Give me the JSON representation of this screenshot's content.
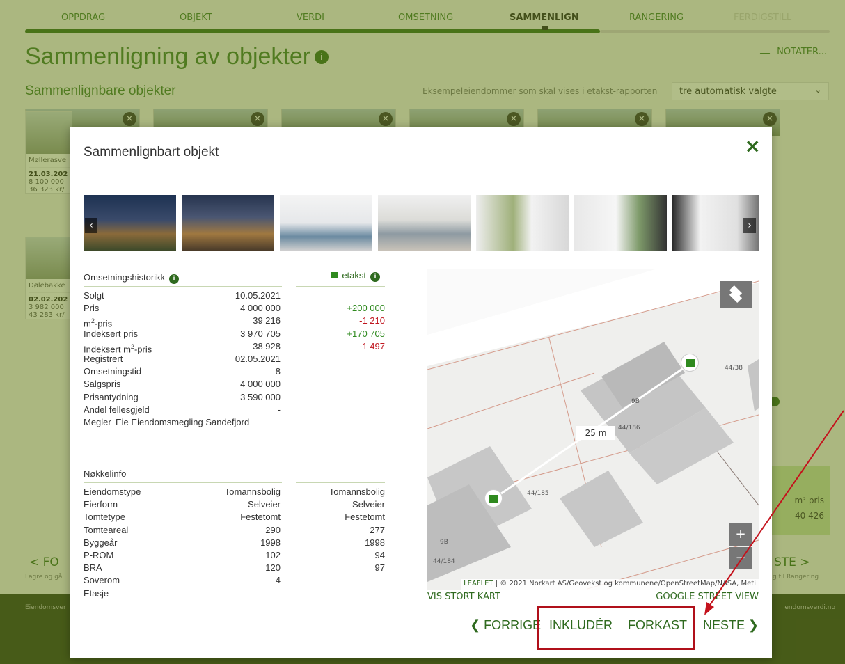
{
  "background": {
    "steps": [
      "OPPDRAG",
      "OBJEKT",
      "VERDI",
      "OMSETNING",
      "SAMMENLIGN",
      "RANGERING",
      "FERDIGSTILL"
    ],
    "active_step": "SAMMENLIGN",
    "page_title": "Sammenligning av objekter",
    "notater_label": "NOTATER...",
    "section_title": "Sammenlignbare objekter",
    "example_label": "Eksempeleiendommer som skal vises i etakst-rapporten",
    "example_select": "tre automatisk valgte",
    "cards": [
      {
        "addr": "Møllerasve",
        "date": "21.03.202",
        "price": "8 100 000",
        "sqm": "36 323 kr/"
      },
      {
        "addr": "Dølebakke",
        "date": "02.02.202",
        "price": "3 982 000",
        "sqm": "43 283 kr/"
      }
    ],
    "nav_prev": "< FO",
    "nav_prev_sub": "Lagre og gå",
    "nav_next": "STE >",
    "nav_next_sub": "g til Rangering",
    "right_box_label": "m² pris",
    "right_box_value": "40 426",
    "footer_left": "Eiendomsver",
    "footer_right": "endomsverdi.no"
  },
  "modal": {
    "title": "Sammenlignbart objekt",
    "close_icon": "×",
    "history_header": "Omsetningshistorikk",
    "etakst_header": "etakst",
    "history": [
      {
        "label": "Solgt",
        "v1": "10.05.2021",
        "v2": ""
      },
      {
        "label": "Pris",
        "v1": "4 000 000",
        "v2": "+200 000",
        "v2_tone": "pos"
      },
      {
        "label": "m²-pris",
        "v1": "39 216",
        "v2": "-1 210",
        "v2_tone": "neg"
      },
      {
        "label": "Indeksert pris",
        "v1": "3 970 705",
        "v2": "+170 705",
        "v2_tone": "pos"
      },
      {
        "label": "Indeksert m²-pris",
        "v1": "38 928",
        "v2": "-1 497",
        "v2_tone": "neg"
      },
      {
        "label": "Registrert",
        "v1": "02.05.2021",
        "v2": ""
      },
      {
        "label": "Omsetningstid",
        "v1": "8",
        "v2": ""
      },
      {
        "label": "Salgspris",
        "v1": "4 000 000",
        "v2": ""
      },
      {
        "label": "Prisantydning",
        "v1": "3 590 000",
        "v2": ""
      },
      {
        "label": "Andel fellesgjeld",
        "v1": "-",
        "v2": ""
      }
    ],
    "megler_label": "Megler",
    "megler_value": "Eie Eiendomsmegling Sandefjord",
    "key_header": "Nøkkelinfo",
    "key_info": [
      {
        "label": "Eiendomstype",
        "v1": "Tomannsbolig",
        "v2": "Tomannsbolig"
      },
      {
        "label": "Eierform",
        "v1": "Selveier",
        "v2": "Selveier"
      },
      {
        "label": "Tomtetype",
        "v1": "Festetomt",
        "v2": "Festetomt"
      },
      {
        "label": "Tomteareal",
        "v1": "290",
        "v2": "277"
      },
      {
        "label": "Byggeår",
        "v1": "1998",
        "v2": "1998"
      },
      {
        "label": "P-ROM",
        "v1": "102",
        "v2": "94"
      },
      {
        "label": "BRA",
        "v1": "120",
        "v2": "97"
      },
      {
        "label": "Soverom",
        "v1": "4",
        "v2": ""
      },
      {
        "label": "Etasje",
        "v1": "",
        "v2": ""
      }
    ],
    "map": {
      "distance": "25 m",
      "attribution_leaflet": "LEAFLET",
      "attribution_text": " | © 2021 Norkart AS/Geovekst og kommunene/OpenStreetMap/NASA, Meti",
      "labels": [
        "44/38",
        "9B",
        "44/186",
        "44/185",
        "9B",
        "44/184"
      ],
      "zoom_in": "+",
      "zoom_out": "−"
    },
    "link_big_map": "VIS STORT KART",
    "link_street_view": "GOOGLE STREET VIEW",
    "btn_prev": "❮ FORRIGE",
    "btn_include": "INKLUDÉR",
    "btn_discard": "FORKAST",
    "btn_next": "NESTE ❯"
  },
  "colors": {
    "accent": "#2f6a1f",
    "positive": "#2f8a1f",
    "negative": "#c0161f",
    "highlight": "#b0101a"
  }
}
